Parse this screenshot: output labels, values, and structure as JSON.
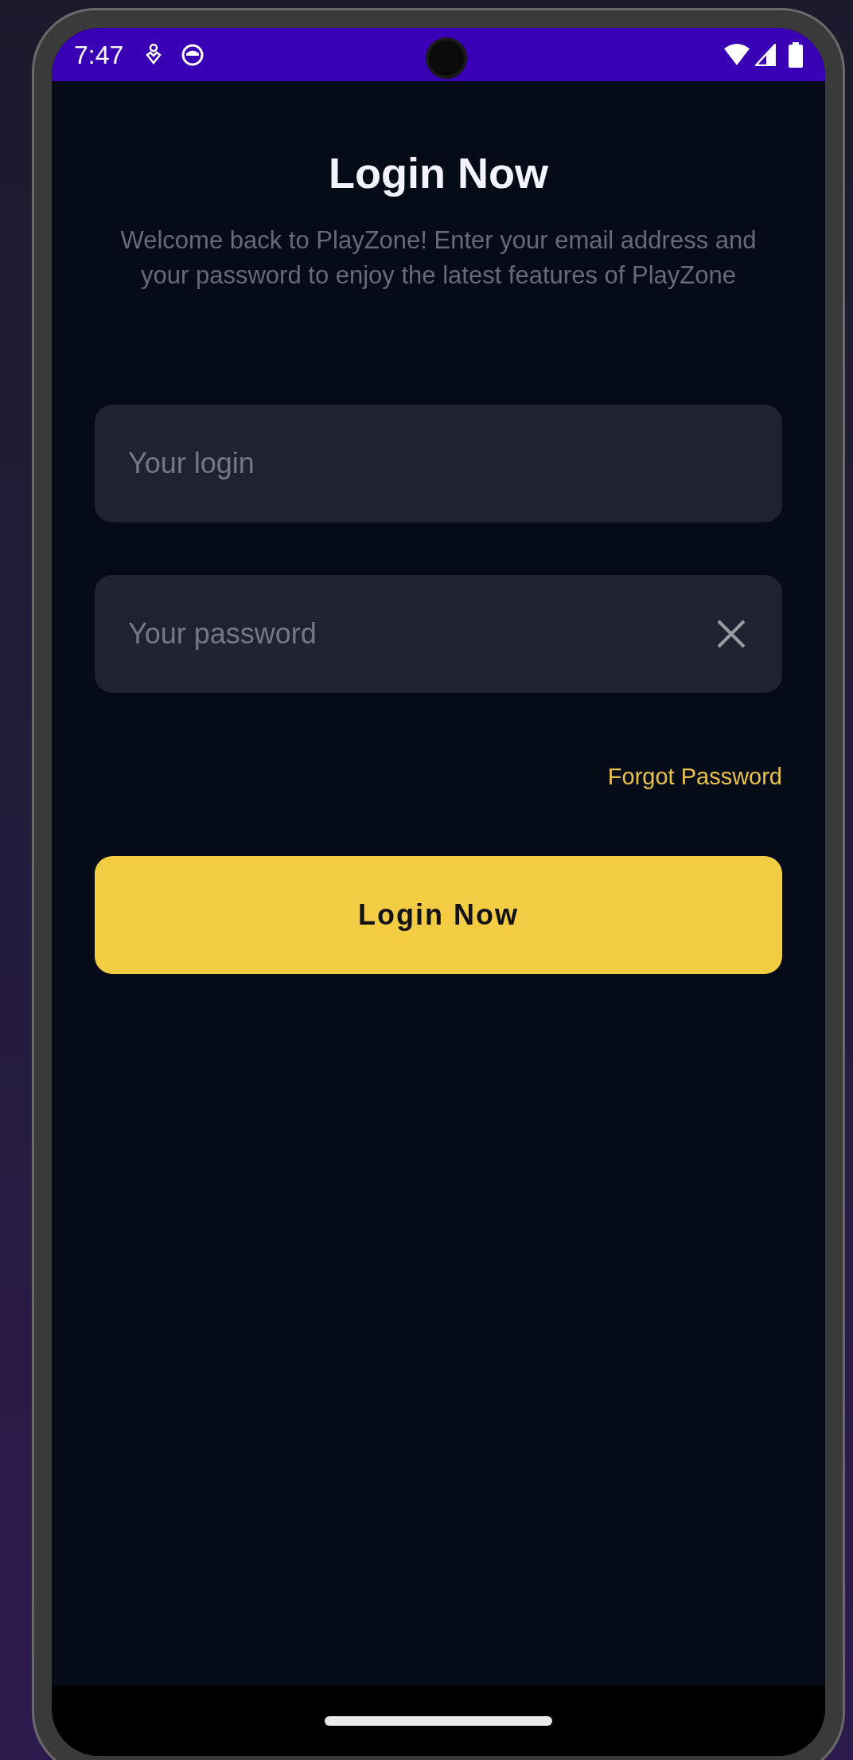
{
  "status_bar": {
    "time": "7:47"
  },
  "title": "Login Now",
  "description": "Welcome back to PlayZone! Enter your email address and your password to enjoy the latest features of PlayZone",
  "fields": [
    {
      "placeholder": "Your login",
      "clear_button": false
    },
    {
      "placeholder": "Your password",
      "clear_button": true
    }
  ],
  "forgot_link": "Forgot Password",
  "primary_button": "Login Now"
}
